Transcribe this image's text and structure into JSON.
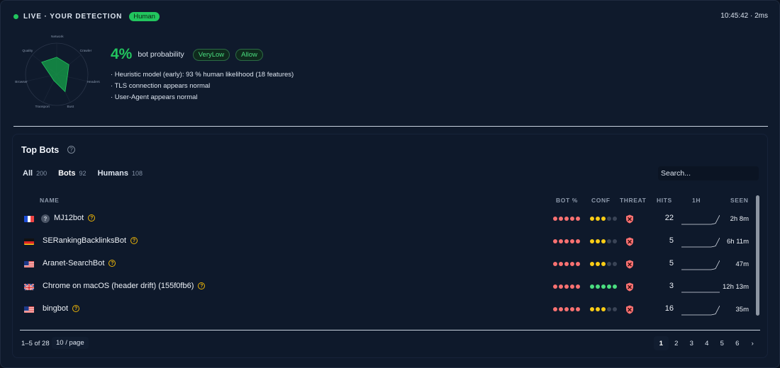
{
  "live": {
    "label": "LIVE · YOUR DETECTION",
    "status_badge": "Human",
    "clock": "10:45:42 · 2ms"
  },
  "radar": {
    "axes": [
      "Network",
      "Crawler",
      "Headers",
      "Bust",
      "Transport",
      "Browser",
      "Quality"
    ],
    "values": [
      0.55,
      0.5,
      0.35,
      0.62,
      0.22,
      0.2,
      0.62
    ]
  },
  "detection": {
    "probability": "4%",
    "probability_label": "bot probability",
    "risk_badge": "VeryLow",
    "action_badge": "Allow",
    "notes": [
      "· Heuristic model (early): 93 % human likelihood (18 features)",
      "· TLS connection appears normal",
      "· User-Agent appears normal"
    ]
  },
  "top_bots": {
    "title": "Top Bots",
    "help_glyph": "?",
    "tabs": [
      {
        "label": "All",
        "count": "200"
      },
      {
        "label": "Bots",
        "count": "92"
      },
      {
        "label": "Humans",
        "count": "108"
      }
    ],
    "active_tab": 1,
    "search_placeholder": "Search...",
    "columns": {
      "name": "NAME",
      "bot_pct": "BOT %",
      "conf": "CONF",
      "threat": "THREAT",
      "hits": "HITS",
      "hour": "1H",
      "seen": "SEEN"
    },
    "rows": [
      {
        "flag": "fr",
        "unknown": true,
        "name": "MJ12bot",
        "bot_dots": 5,
        "conf_dots": 3,
        "conf_color": "yellow",
        "hits": "22",
        "seen": "2h 8m",
        "spark": [
          0,
          0,
          0,
          0,
          0,
          0,
          0,
          0,
          0.1,
          1
        ]
      },
      {
        "flag": "de",
        "unknown": false,
        "name": "SERankingBacklinksBot",
        "bot_dots": 5,
        "conf_dots": 3,
        "conf_color": "yellow",
        "hits": "5",
        "seen": "6h 11m",
        "spark": [
          0,
          0,
          0,
          0,
          0,
          0,
          0,
          0,
          0.1,
          1
        ]
      },
      {
        "flag": "us",
        "unknown": false,
        "name": "Aranet-SearchBot",
        "bot_dots": 5,
        "conf_dots": 3,
        "conf_color": "yellow",
        "hits": "5",
        "seen": "47m",
        "spark": [
          0,
          0,
          0,
          0,
          0,
          0,
          0,
          0,
          0.1,
          1
        ]
      },
      {
        "flag": "gb",
        "unknown": false,
        "name": "Chrome on macOS (header drift) (155f0fb6)",
        "bot_dots": 5,
        "conf_dots": 5,
        "conf_color": "green",
        "hits": "3",
        "seen": "12h 13m",
        "spark": [
          0,
          0,
          0,
          0,
          0,
          0,
          0,
          0,
          0,
          0
        ]
      },
      {
        "flag": "us",
        "unknown": false,
        "name": "bingbot",
        "bot_dots": 5,
        "conf_dots": 3,
        "conf_color": "yellow",
        "hits": "16",
        "seen": "35m",
        "spark": [
          0,
          0,
          0,
          0,
          0,
          0,
          0,
          0,
          0.1,
          1
        ]
      }
    ],
    "footer": {
      "range": "1–5 of 28",
      "per_page": "10 / page",
      "pages": [
        "1",
        "2",
        "3",
        "4",
        "5",
        "6",
        "›"
      ],
      "current_page": 0
    }
  },
  "colors": {
    "accent_green": "#22c55e",
    "danger": "#f87171",
    "warning": "#facc15"
  },
  "icons": {
    "threat": "shield-x-icon",
    "unknown": "question-icon",
    "help": "help-circle-icon"
  }
}
